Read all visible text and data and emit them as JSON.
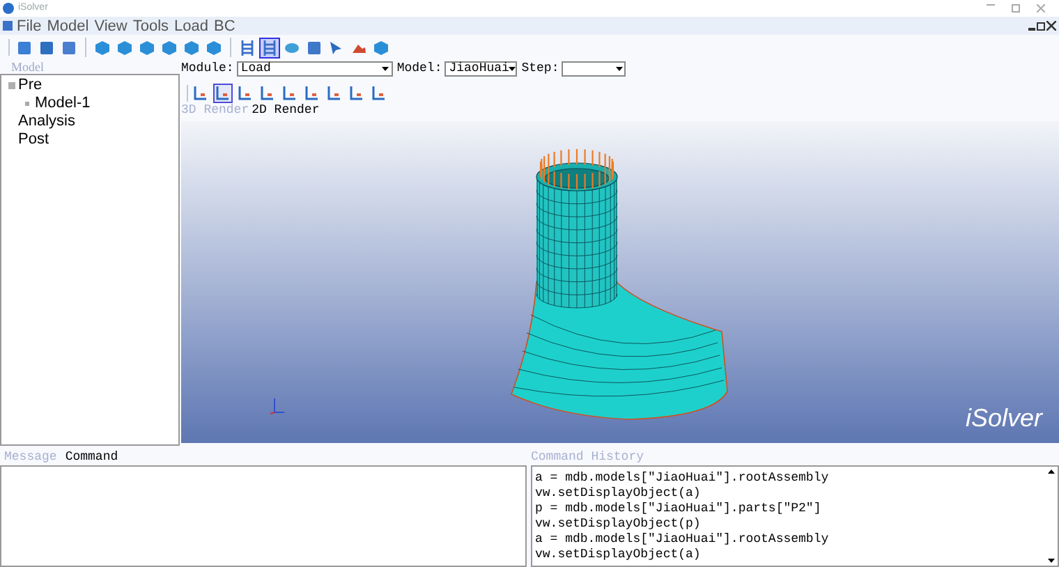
{
  "window": {
    "title": "iSolver"
  },
  "menu": [
    "File",
    "Model",
    "View",
    "Tools",
    "Load",
    "BC"
  ],
  "toolbar": [
    {
      "kind": "file",
      "selected": false
    },
    {
      "kind": "folder",
      "selected": false
    },
    {
      "kind": "save",
      "selected": false
    },
    {
      "kind": "sep"
    },
    {
      "kind": "cube",
      "selected": false
    },
    {
      "kind": "cube",
      "selected": false
    },
    {
      "kind": "cube",
      "selected": false
    },
    {
      "kind": "cube",
      "selected": false
    },
    {
      "kind": "cube",
      "selected": false
    },
    {
      "kind": "cube",
      "selected": false
    },
    {
      "kind": "sep"
    },
    {
      "kind": "grid",
      "selected": false
    },
    {
      "kind": "grid",
      "selected": true
    },
    {
      "kind": "disk",
      "selected": false
    },
    {
      "kind": "panel",
      "selected": false
    },
    {
      "kind": "cursor",
      "selected": false
    },
    {
      "kind": "cloud",
      "selected": false
    },
    {
      "kind": "cube",
      "selected": false
    }
  ],
  "tree": {
    "title": "Model",
    "items": [
      {
        "label": "Pre",
        "expanded": true,
        "children": [
          {
            "label": "Model-1"
          }
        ]
      },
      {
        "label": "Analysis"
      },
      {
        "label": "Post"
      }
    ]
  },
  "selectors": [
    {
      "label": "Module:",
      "value": "Load"
    },
    {
      "label": "Model:",
      "value": "JiaoHuai"
    },
    {
      "label": "Step:"
    }
  ],
  "view_toolbar": [
    {
      "selected": false
    },
    {
      "selected": true
    },
    {
      "selected": false
    },
    {
      "selected": false
    },
    {
      "selected": false
    },
    {
      "selected": false
    },
    {
      "selected": false
    },
    {
      "selected": false
    },
    {
      "selected": false
    }
  ],
  "render_tabs": [
    {
      "label": "3D Render",
      "selected": false
    },
    {
      "label": "2D Render",
      "selected": true
    }
  ],
  "viewport": {
    "logo": "iSolver"
  },
  "bottom_tabs": [
    {
      "label": "Message",
      "selected": false
    },
    {
      "label": "Command",
      "selected": true
    }
  ],
  "history": {
    "title": "Command History",
    "lines": [
      "a = mdb.models[\"JiaoHuai\"].rootAssembly",
      "vw.setDisplayObject(a)",
      "p = mdb.models[\"JiaoHuai\"].parts[\"P2\"]",
      "vw.setDisplayObject(p)",
      "a = mdb.models[\"JiaoHuai\"].rootAssembly",
      "vw.setDisplayObject(a)"
    ]
  }
}
